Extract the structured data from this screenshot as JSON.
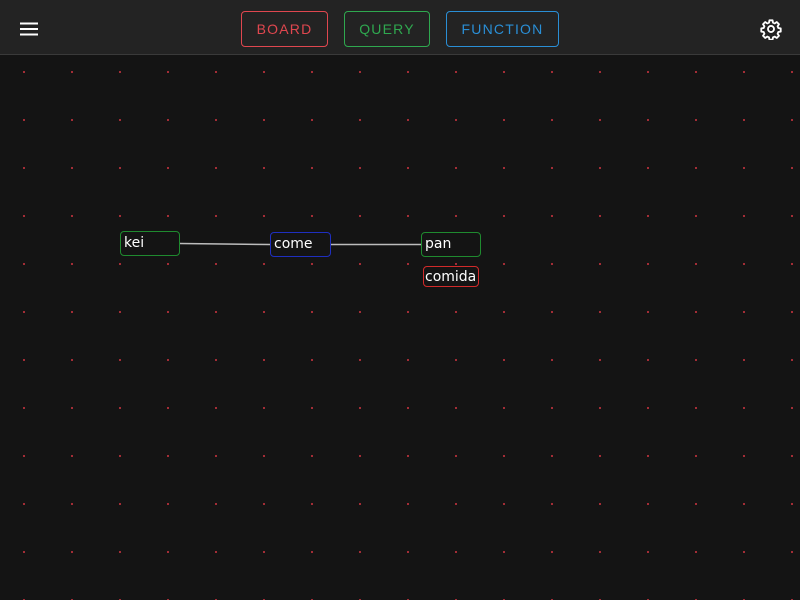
{
  "toolbar": {
    "menu_icon": "hamburger-menu-icon",
    "settings_icon": "gear-icon",
    "tabs": [
      {
        "label": "BOARD",
        "color": "#e0474f"
      },
      {
        "label": "QUERY",
        "color": "#2fa84f"
      },
      {
        "label": "FUNCTION",
        "color": "#2a8fd6"
      }
    ]
  },
  "canvas": {
    "dot_color": "#b8313b",
    "background": "#141414",
    "edge_color": "#bdbdbd",
    "nodes": [
      {
        "label": "kei",
        "border_color": "#1f8a2f"
      },
      {
        "label": "come",
        "border_color": "#1f2fc0"
      },
      {
        "label": "pan",
        "border_color": "#1f8a2f"
      },
      {
        "label": "comida",
        "border_color": "#d22a2a"
      }
    ]
  }
}
